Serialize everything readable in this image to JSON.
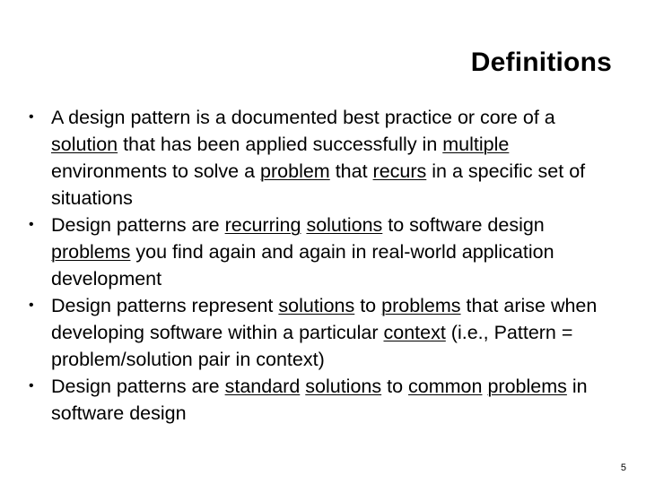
{
  "slide": {
    "title": "Definitions",
    "page_number": "5",
    "bullet_glyph": "•",
    "bullets": [
      {
        "id": "bullet-1",
        "plain_text": "A design pattern is a documented best practice or core of a solution that has been applied successfully in multiple environments to solve a problem that recurs in a specific set of situations",
        "runs": [
          {
            "text": "A design pattern is a documented best practice or core of a ",
            "underline": false
          },
          {
            "text": "solution",
            "underline": true
          },
          {
            "text": " that has been applied successfully in ",
            "underline": false
          },
          {
            "text": "multiple",
            "underline": true
          },
          {
            "text": " environments to solve a ",
            "underline": false
          },
          {
            "text": "problem",
            "underline": true
          },
          {
            "text": " that ",
            "underline": false
          },
          {
            "text": "recurs",
            "underline": true
          },
          {
            "text": " in a specific set of situations",
            "underline": false
          }
        ]
      },
      {
        "id": "bullet-2",
        "plain_text": "Design patterns are recurring solutions to software design problems you find again and again in real-world application development",
        "runs": [
          {
            "text": "Design patterns are ",
            "underline": false
          },
          {
            "text": "recurring",
            "underline": true
          },
          {
            "text": " ",
            "underline": false
          },
          {
            "text": "solutions",
            "underline": true
          },
          {
            "text": " to software design ",
            "underline": false
          },
          {
            "text": "problems",
            "underline": true
          },
          {
            "text": " you find again and again in real-world application development",
            "underline": false
          }
        ]
      },
      {
        "id": "bullet-3",
        "plain_text": "Design patterns represent solutions to problems that arise when developing software within a particular context (i.e., Pattern = problem/solution pair in context)",
        "runs": [
          {
            "text": "Design patterns represent ",
            "underline": false
          },
          {
            "text": "solutions",
            "underline": true
          },
          {
            "text": " to ",
            "underline": false
          },
          {
            "text": "problems",
            "underline": true
          },
          {
            "text": " that arise when developing software within a particular ",
            "underline": false
          },
          {
            "text": "context",
            "underline": true
          },
          {
            "text": " (i.e., Pattern = problem/solution pair in context)",
            "underline": false
          }
        ]
      },
      {
        "id": "bullet-4",
        "plain_text": "Design patterns are standard solutions to common problems in software design",
        "runs": [
          {
            "text": "Design patterns are ",
            "underline": false
          },
          {
            "text": "standard",
            "underline": true
          },
          {
            "text": " ",
            "underline": false
          },
          {
            "text": "solutions",
            "underline": true
          },
          {
            "text": " to ",
            "underline": false
          },
          {
            "text": "common",
            "underline": true
          },
          {
            "text": " ",
            "underline": false
          },
          {
            "text": "problems",
            "underline": true
          },
          {
            "text": " in software design",
            "underline": false
          }
        ]
      }
    ]
  },
  "colors": {
    "background": "#ffffff",
    "text": "#000000"
  }
}
